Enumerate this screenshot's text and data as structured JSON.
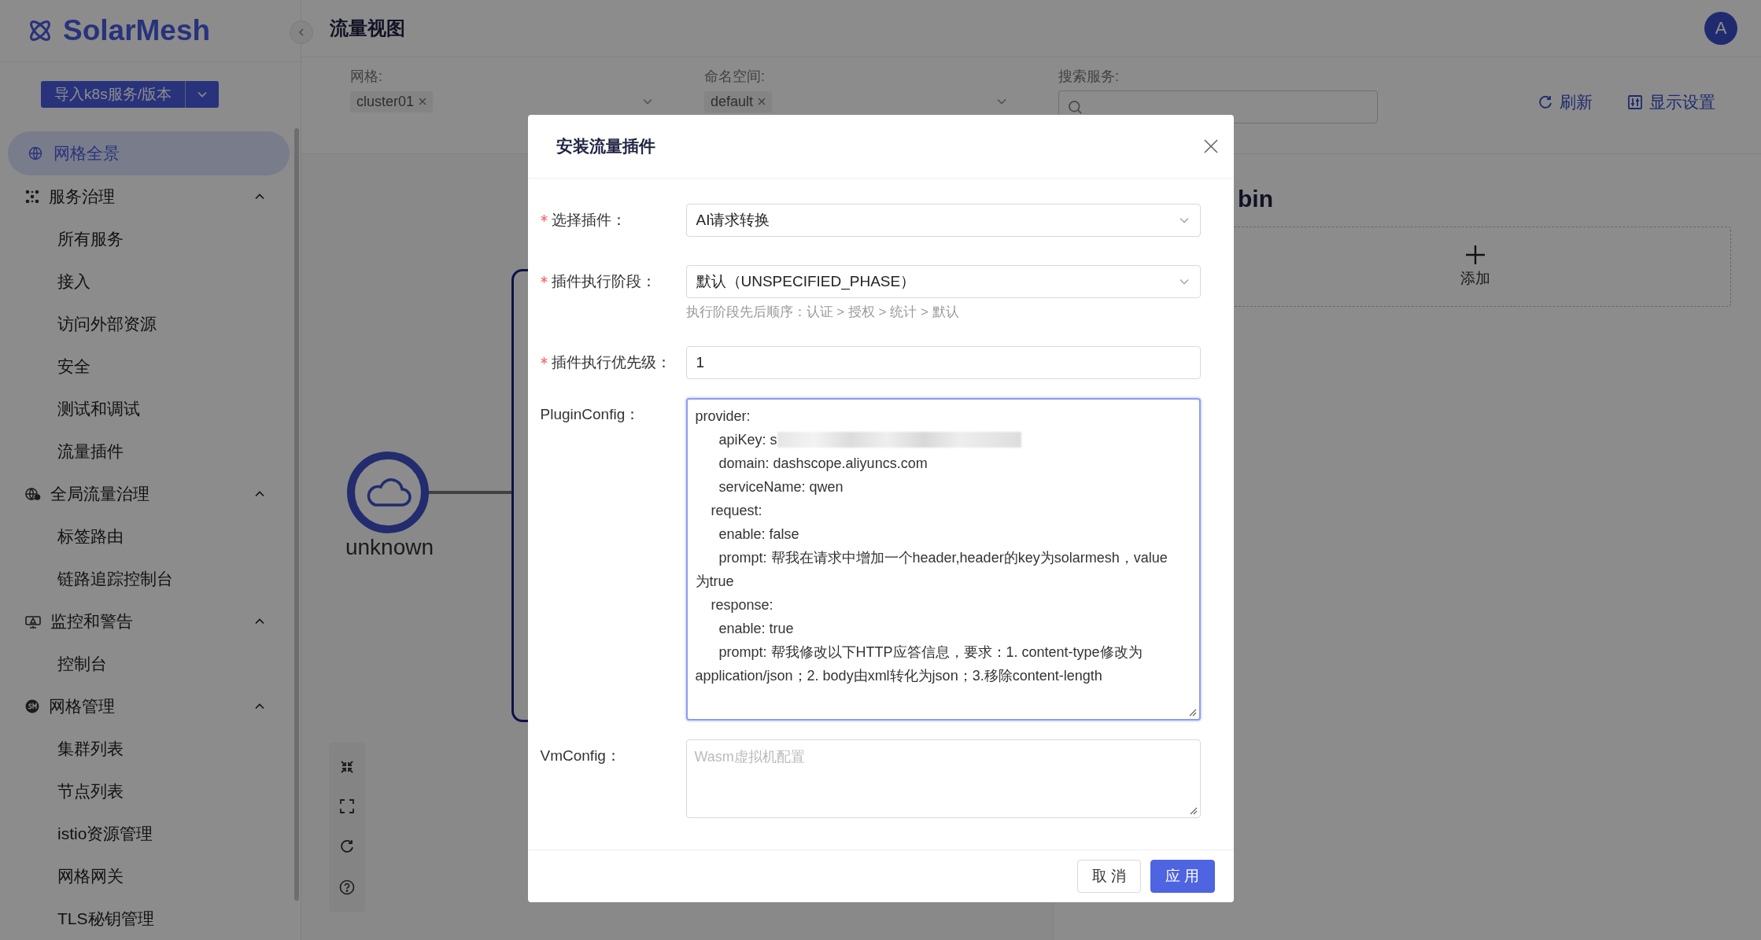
{
  "sidebar": {
    "logo": "SolarMesh",
    "import_button": "导入k8s服务/版本",
    "items": [
      {
        "label": "网格全景",
        "kind": "top",
        "selected": true
      },
      {
        "label": "服务治理",
        "kind": "group",
        "expanded": true,
        "children": [
          {
            "label": "所有服务",
            "selected": false
          },
          {
            "label": "接入",
            "selected": false
          },
          {
            "label": "访问外部资源",
            "selected": false
          },
          {
            "label": "安全",
            "selected": false
          },
          {
            "label": "测试和调试",
            "selected": false
          },
          {
            "label": "流量插件",
            "selected": false
          }
        ]
      },
      {
        "label": "全局流量治理",
        "kind": "group",
        "expanded": true,
        "children": [
          {
            "label": "标签路由",
            "selected": false
          },
          {
            "label": "链路追踪控制台",
            "selected": false
          }
        ]
      },
      {
        "label": "监控和警告",
        "kind": "group",
        "expanded": true,
        "children": [
          {
            "label": "控制台",
            "selected": false
          }
        ]
      },
      {
        "label": "网格管理",
        "kind": "group",
        "expanded": true,
        "children": [
          {
            "label": "集群列表",
            "selected": false
          },
          {
            "label": "节点列表",
            "selected": false
          },
          {
            "label": "istio资源管理",
            "selected": false
          },
          {
            "label": "网格网关",
            "selected": false
          },
          {
            "label": "TLS秘钥管理",
            "selected": false
          }
        ]
      }
    ]
  },
  "header": {
    "title": "流量视图",
    "avatar": "A"
  },
  "filters": [
    {
      "label": "网格:",
      "kind": "select",
      "tag": "cluster01"
    },
    {
      "label": "命名空间:",
      "kind": "select",
      "tag": "default"
    },
    {
      "label": "搜索服务:",
      "kind": "search"
    }
  ],
  "actions": [
    {
      "label": "刷新",
      "kind": "refresh"
    },
    {
      "label": "显示设置",
      "kind": "settings"
    }
  ],
  "canvas": {
    "node": "unknown"
  },
  "right_panel": {
    "title": "bin",
    "add": "添加"
  },
  "modal": {
    "title": "安装流量插件",
    "fields": [
      {
        "label": "选择插件：",
        "required": true,
        "kind": "select",
        "value": "AI请求转换"
      },
      {
        "label": "插件执行阶段：",
        "required": true,
        "kind": "select",
        "value": "默认（UNSPECIFIED_PHASE）",
        "hint": "执行阶段先后顺序：认证 > 授权 > 统计 > 默认"
      },
      {
        "label": "插件执行优先级：",
        "required": true,
        "kind": "input",
        "value": "1"
      },
      {
        "label": "PluginConfig：",
        "required": false,
        "kind": "textarea",
        "focused": true,
        "lines": [
          {
            "text": "provider:",
            "redacted": false
          },
          {
            "text": "      apiKey: s",
            "redacted": true
          },
          {
            "text": "      domain: dashscope.aliyuncs.com",
            "redacted": false
          },
          {
            "text": "      serviceName: qwen",
            "redacted": false
          },
          {
            "text": "    request:",
            "redacted": false
          },
          {
            "text": "      enable: false",
            "redacted": false
          },
          {
            "text": "      prompt: 帮我在请求中增加一个header,header的key为solarmesh，value",
            "redacted": false
          },
          {
            "text": "为true",
            "redacted": false
          },
          {
            "text": "    response:",
            "redacted": false
          },
          {
            "text": "      enable: true",
            "redacted": false
          },
          {
            "text": "      prompt: 帮我修改以下HTTP应答信息，要求：1. content-type修改为",
            "redacted": false
          },
          {
            "text": "application/json；2. body由xml转化为json；3.移除content-length",
            "redacted": false
          }
        ]
      },
      {
        "label": "VmConfig：",
        "required": false,
        "kind": "textarea",
        "focused": false,
        "placeholder": "Wasm虚拟机配置"
      }
    ],
    "buttons": [
      {
        "label": "取 消",
        "kind": "default"
      },
      {
        "label": "应 用",
        "kind": "primary"
      }
    ]
  }
}
